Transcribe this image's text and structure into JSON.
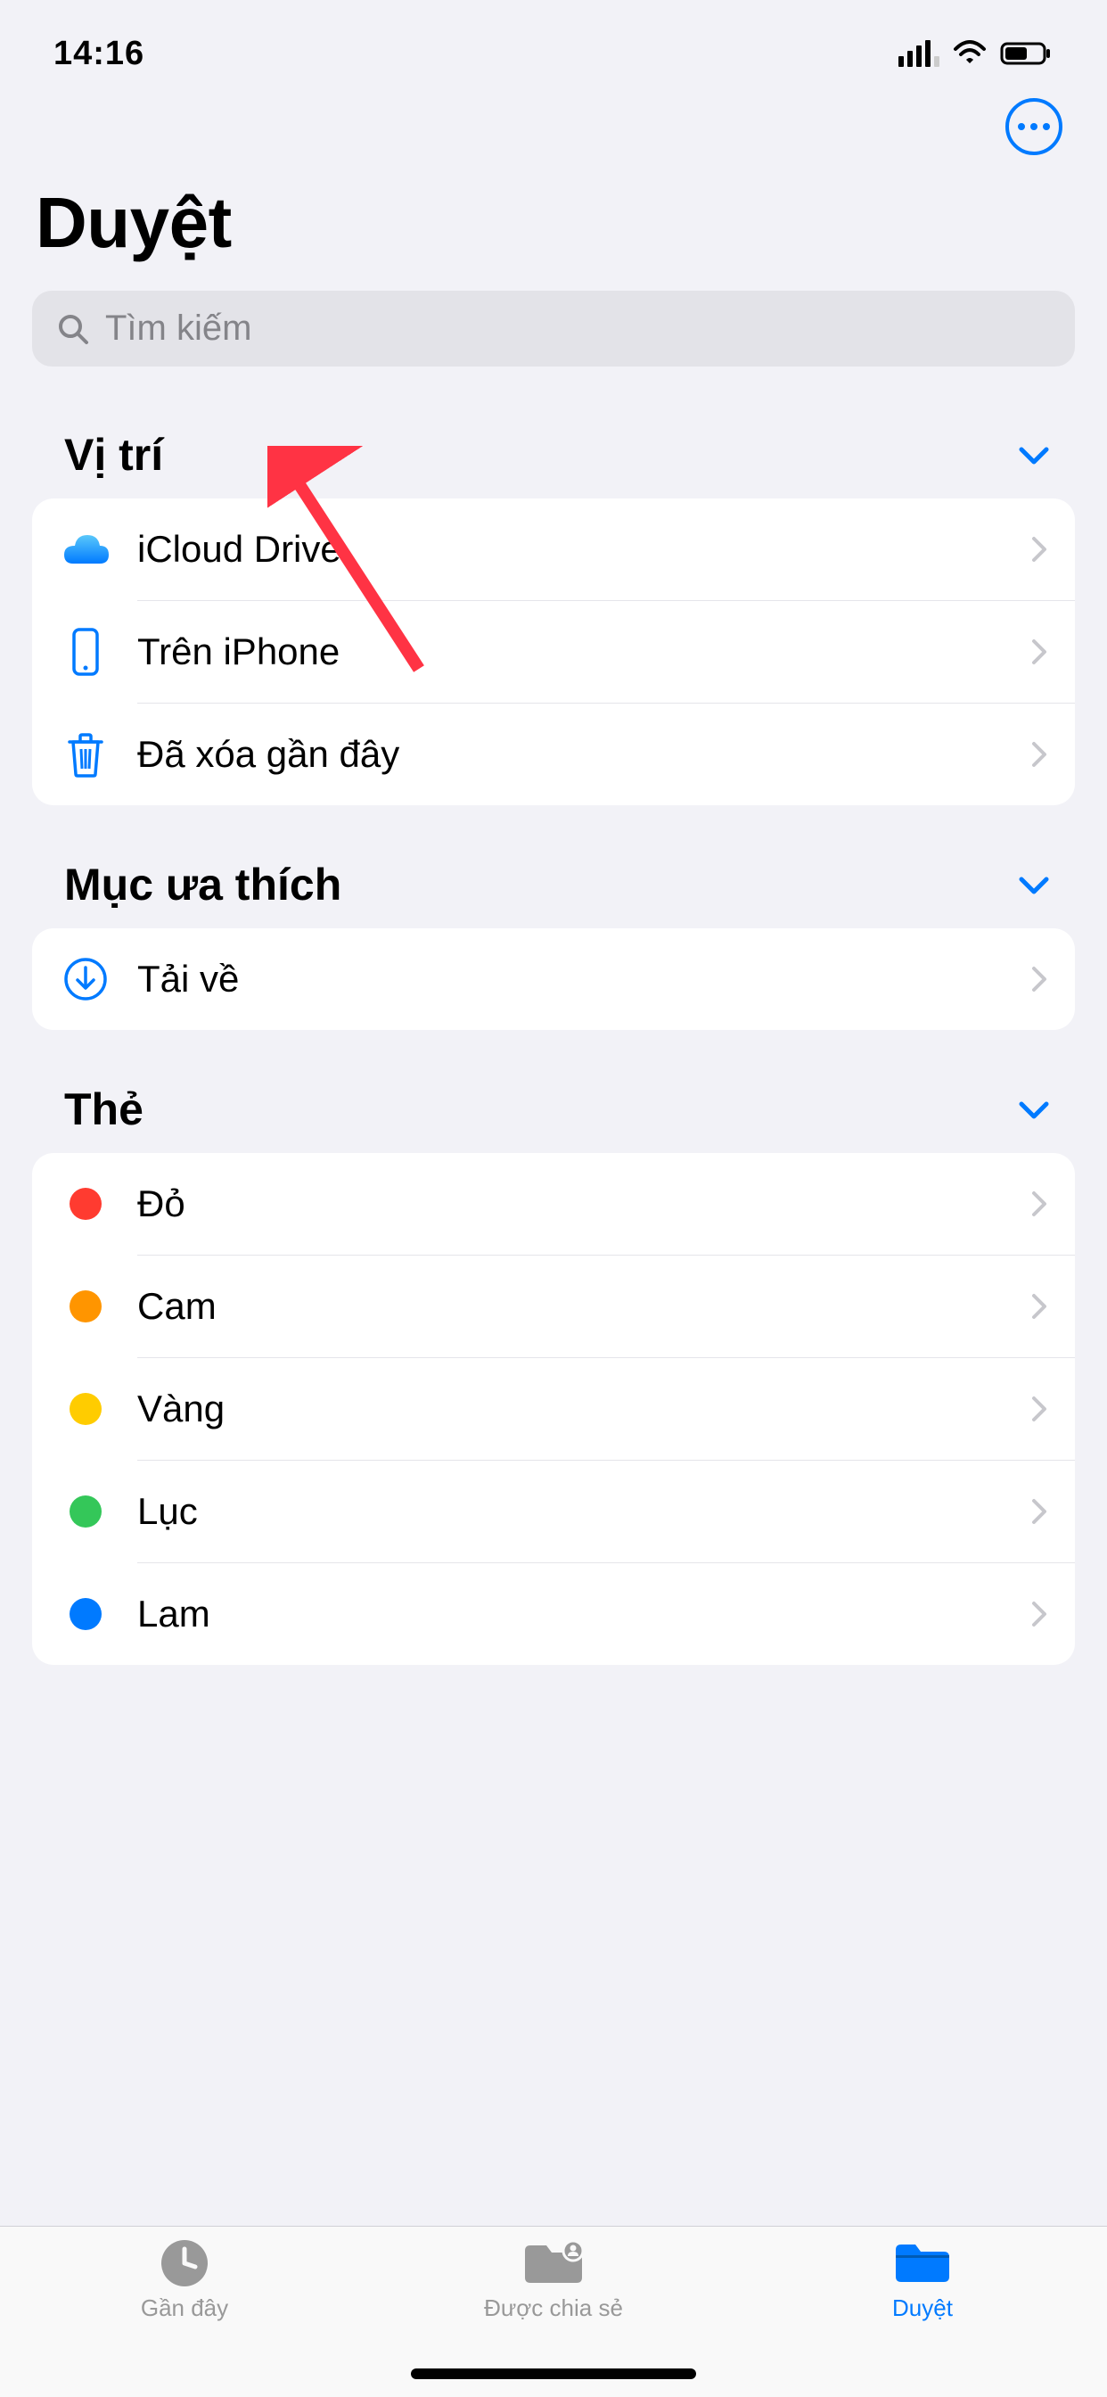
{
  "status": {
    "time": "14:16"
  },
  "page": {
    "title": "Duyệt"
  },
  "search": {
    "placeholder": "Tìm kiếm"
  },
  "sections": {
    "locations": {
      "title": "Vị trí",
      "items": [
        {
          "label": "iCloud Drive",
          "icon": "cloud"
        },
        {
          "label": "Trên iPhone",
          "icon": "iphone"
        },
        {
          "label": "Đã xóa gần đây",
          "icon": "trash"
        }
      ]
    },
    "favorites": {
      "title": "Mục ưa thích",
      "items": [
        {
          "label": "Tải về",
          "icon": "download"
        }
      ]
    },
    "tags": {
      "title": "Thẻ",
      "items": [
        {
          "label": "Đỏ",
          "color": "#ff3b30"
        },
        {
          "label": "Cam",
          "color": "#ff9500"
        },
        {
          "label": "Vàng",
          "color": "#ffcc00"
        },
        {
          "label": "Lục",
          "color": "#34c759"
        },
        {
          "label": "Lam",
          "color": "#007aff"
        }
      ]
    }
  },
  "tabs": [
    {
      "label": "Gần đây",
      "icon": "clock",
      "active": false
    },
    {
      "label": "Được chia sẻ",
      "icon": "shared-folder",
      "active": false
    },
    {
      "label": "Duyệt",
      "icon": "folder",
      "active": true
    }
  ]
}
